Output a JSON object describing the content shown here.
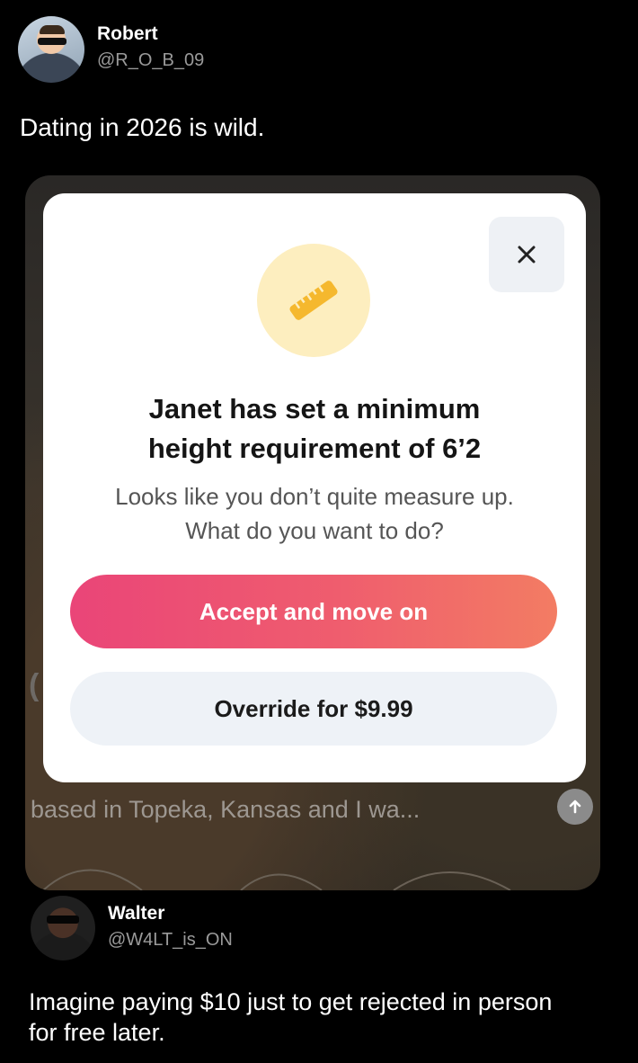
{
  "tweet1": {
    "name": "Robert",
    "handle": "@R_O_B_09",
    "text": "Dating in 2026 is wild."
  },
  "screenshot": {
    "modal": {
      "title_line1": "Janet has set a minimum",
      "title_line2": "height requirement of 6’2",
      "subtitle_line1": "Looks like you don’t quite measure up.",
      "subtitle_line2": "What do you want to do?",
      "accept_label": "Accept and move on",
      "override_label": "Override for $9.99",
      "icon": "ruler-icon",
      "close_icon": "close-icon"
    },
    "bio_preview": "based in Topeka, Kansas and I wa...",
    "up_icon": "arrow-up-icon",
    "colors": {
      "accent_start": "#ea4578",
      "accent_end": "#f37c63",
      "badge_bg": "#fdeebf",
      "ruler": "#f5b82e"
    }
  },
  "tweet2": {
    "name": "Walter",
    "handle": "@W4LT_is_ON",
    "text_line1": "Imagine paying $10 just to get rejected in person",
    "text_line2": "for free later."
  }
}
